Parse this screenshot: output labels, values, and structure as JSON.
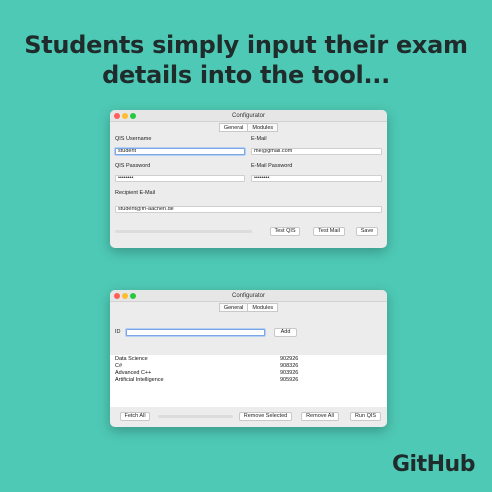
{
  "headline": {
    "line1": "Students simply input their exam",
    "line2": "details into the tool..."
  },
  "window_title": "Configurator",
  "tabs": [
    "General",
    "Modules"
  ],
  "general": {
    "qis_username_label": "QIS Username",
    "qis_username_value": "student",
    "qis_password_label": "QIS Password",
    "qis_password_value": "••••••••",
    "email_label": "E-Mail",
    "email_value": "me@gmail.com",
    "email_password_label": "E-Mail Password",
    "email_password_value": "••••••••",
    "recipient_label": "Recipient E-Mail",
    "recipient_value": "student@fh-aachen.de",
    "buttons": {
      "test_qis": "Test QIS",
      "test_mail": "Test Mail",
      "save": "Save"
    }
  },
  "modules": {
    "id_label": "ID",
    "id_value": "",
    "add_button": "Add",
    "items": [
      {
        "name": "Data Science",
        "id": "902926"
      },
      {
        "name": "C#",
        "id": "908326"
      },
      {
        "name": "Advanced C++",
        "id": "903926"
      },
      {
        "name": "Artificial Intelligence",
        "id": "905926"
      }
    ],
    "buttons": {
      "fetch_all": "Fetch All",
      "remove_selected": "Remove Selected",
      "remove_all": "Remove All",
      "run_qis": "Run QIS"
    }
  },
  "logo_text": "GitHub",
  "colors": {
    "background": "#4ec9b5",
    "headline": "#1f2c2b"
  }
}
